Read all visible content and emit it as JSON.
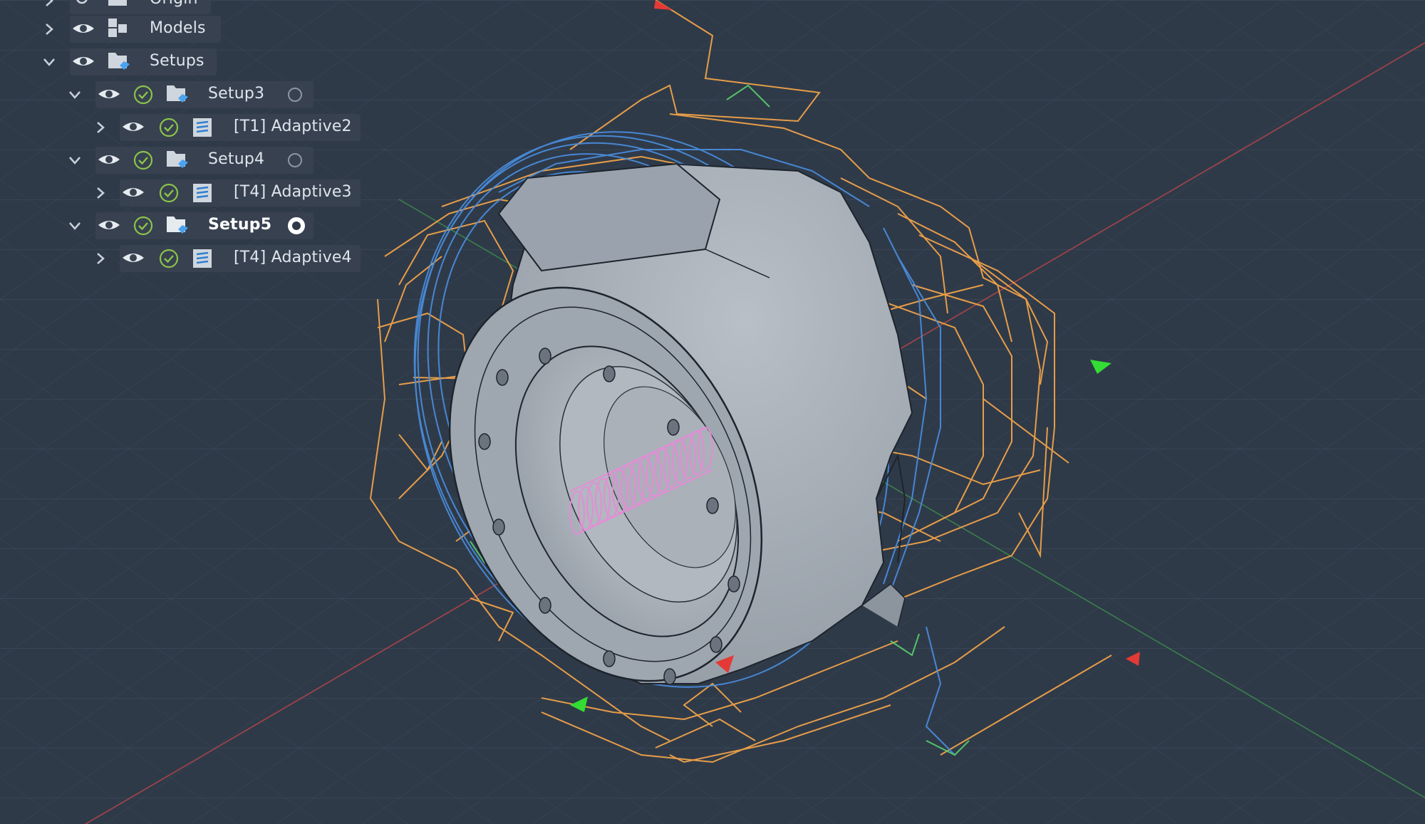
{
  "browser": {
    "items": [
      {
        "label": "Origin",
        "level": 0,
        "expanded": false
      },
      {
        "label": "Models",
        "level": 0,
        "expanded": false
      },
      {
        "label": "Setups",
        "level": 0,
        "expanded": true
      },
      {
        "label": "Setup3",
        "level": 1,
        "expanded": true,
        "valid": true,
        "active": false
      },
      {
        "label": "[T1] Adaptive2",
        "level": 2,
        "expanded": false,
        "valid": true
      },
      {
        "label": "Setup4",
        "level": 1,
        "expanded": true,
        "valid": true,
        "active": false
      },
      {
        "label": "[T4] Adaptive3",
        "level": 2,
        "expanded": false,
        "valid": true
      },
      {
        "label": "Setup5",
        "level": 1,
        "expanded": true,
        "valid": true,
        "active": true
      },
      {
        "label": "[T4] Adaptive4",
        "level": 2,
        "expanded": false,
        "valid": true
      }
    ]
  },
  "icons": {
    "visibility": "eye-icon",
    "status": "check-circle-icon",
    "setup": "setup-folder-icon",
    "operation": "adaptive-toolpath-icon",
    "models": "component-icon",
    "expand": "chevron-right-icon",
    "collapse": "chevron-down-icon"
  },
  "colors": {
    "background": "#2f3a49",
    "grid": "#4a5566",
    "part": "#a9b0b8",
    "rapid_moves": "#f0a348",
    "cutting_moves": "#4a90e2",
    "lead_moves": "#58d36b",
    "plunge_moves": "#e88ad8",
    "x_axis": "#d94848",
    "y_axis": "#3fa34d",
    "check": "#8bc34a"
  }
}
